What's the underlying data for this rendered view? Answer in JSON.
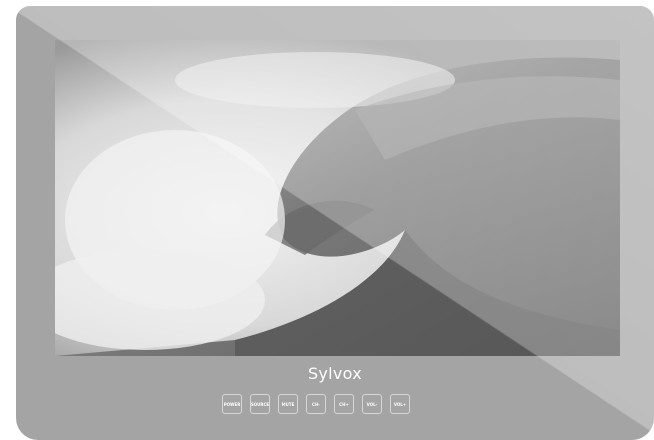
{
  "brand": {
    "logo_text": "Sylvox"
  },
  "screen": {
    "image_description_icon": "ocean-wave-photo"
  },
  "buttons": [
    {
      "label": "POWER"
    },
    {
      "label": "SOURCE"
    },
    {
      "label": "MUTE"
    },
    {
      "label": "CH-"
    },
    {
      "label": "CH+"
    },
    {
      "label": "VOL-"
    },
    {
      "label": "VOL+"
    }
  ],
  "colors": {
    "frame": "#a4a4a4",
    "button_border": "#d6d6d6",
    "text": "#ffffff"
  }
}
